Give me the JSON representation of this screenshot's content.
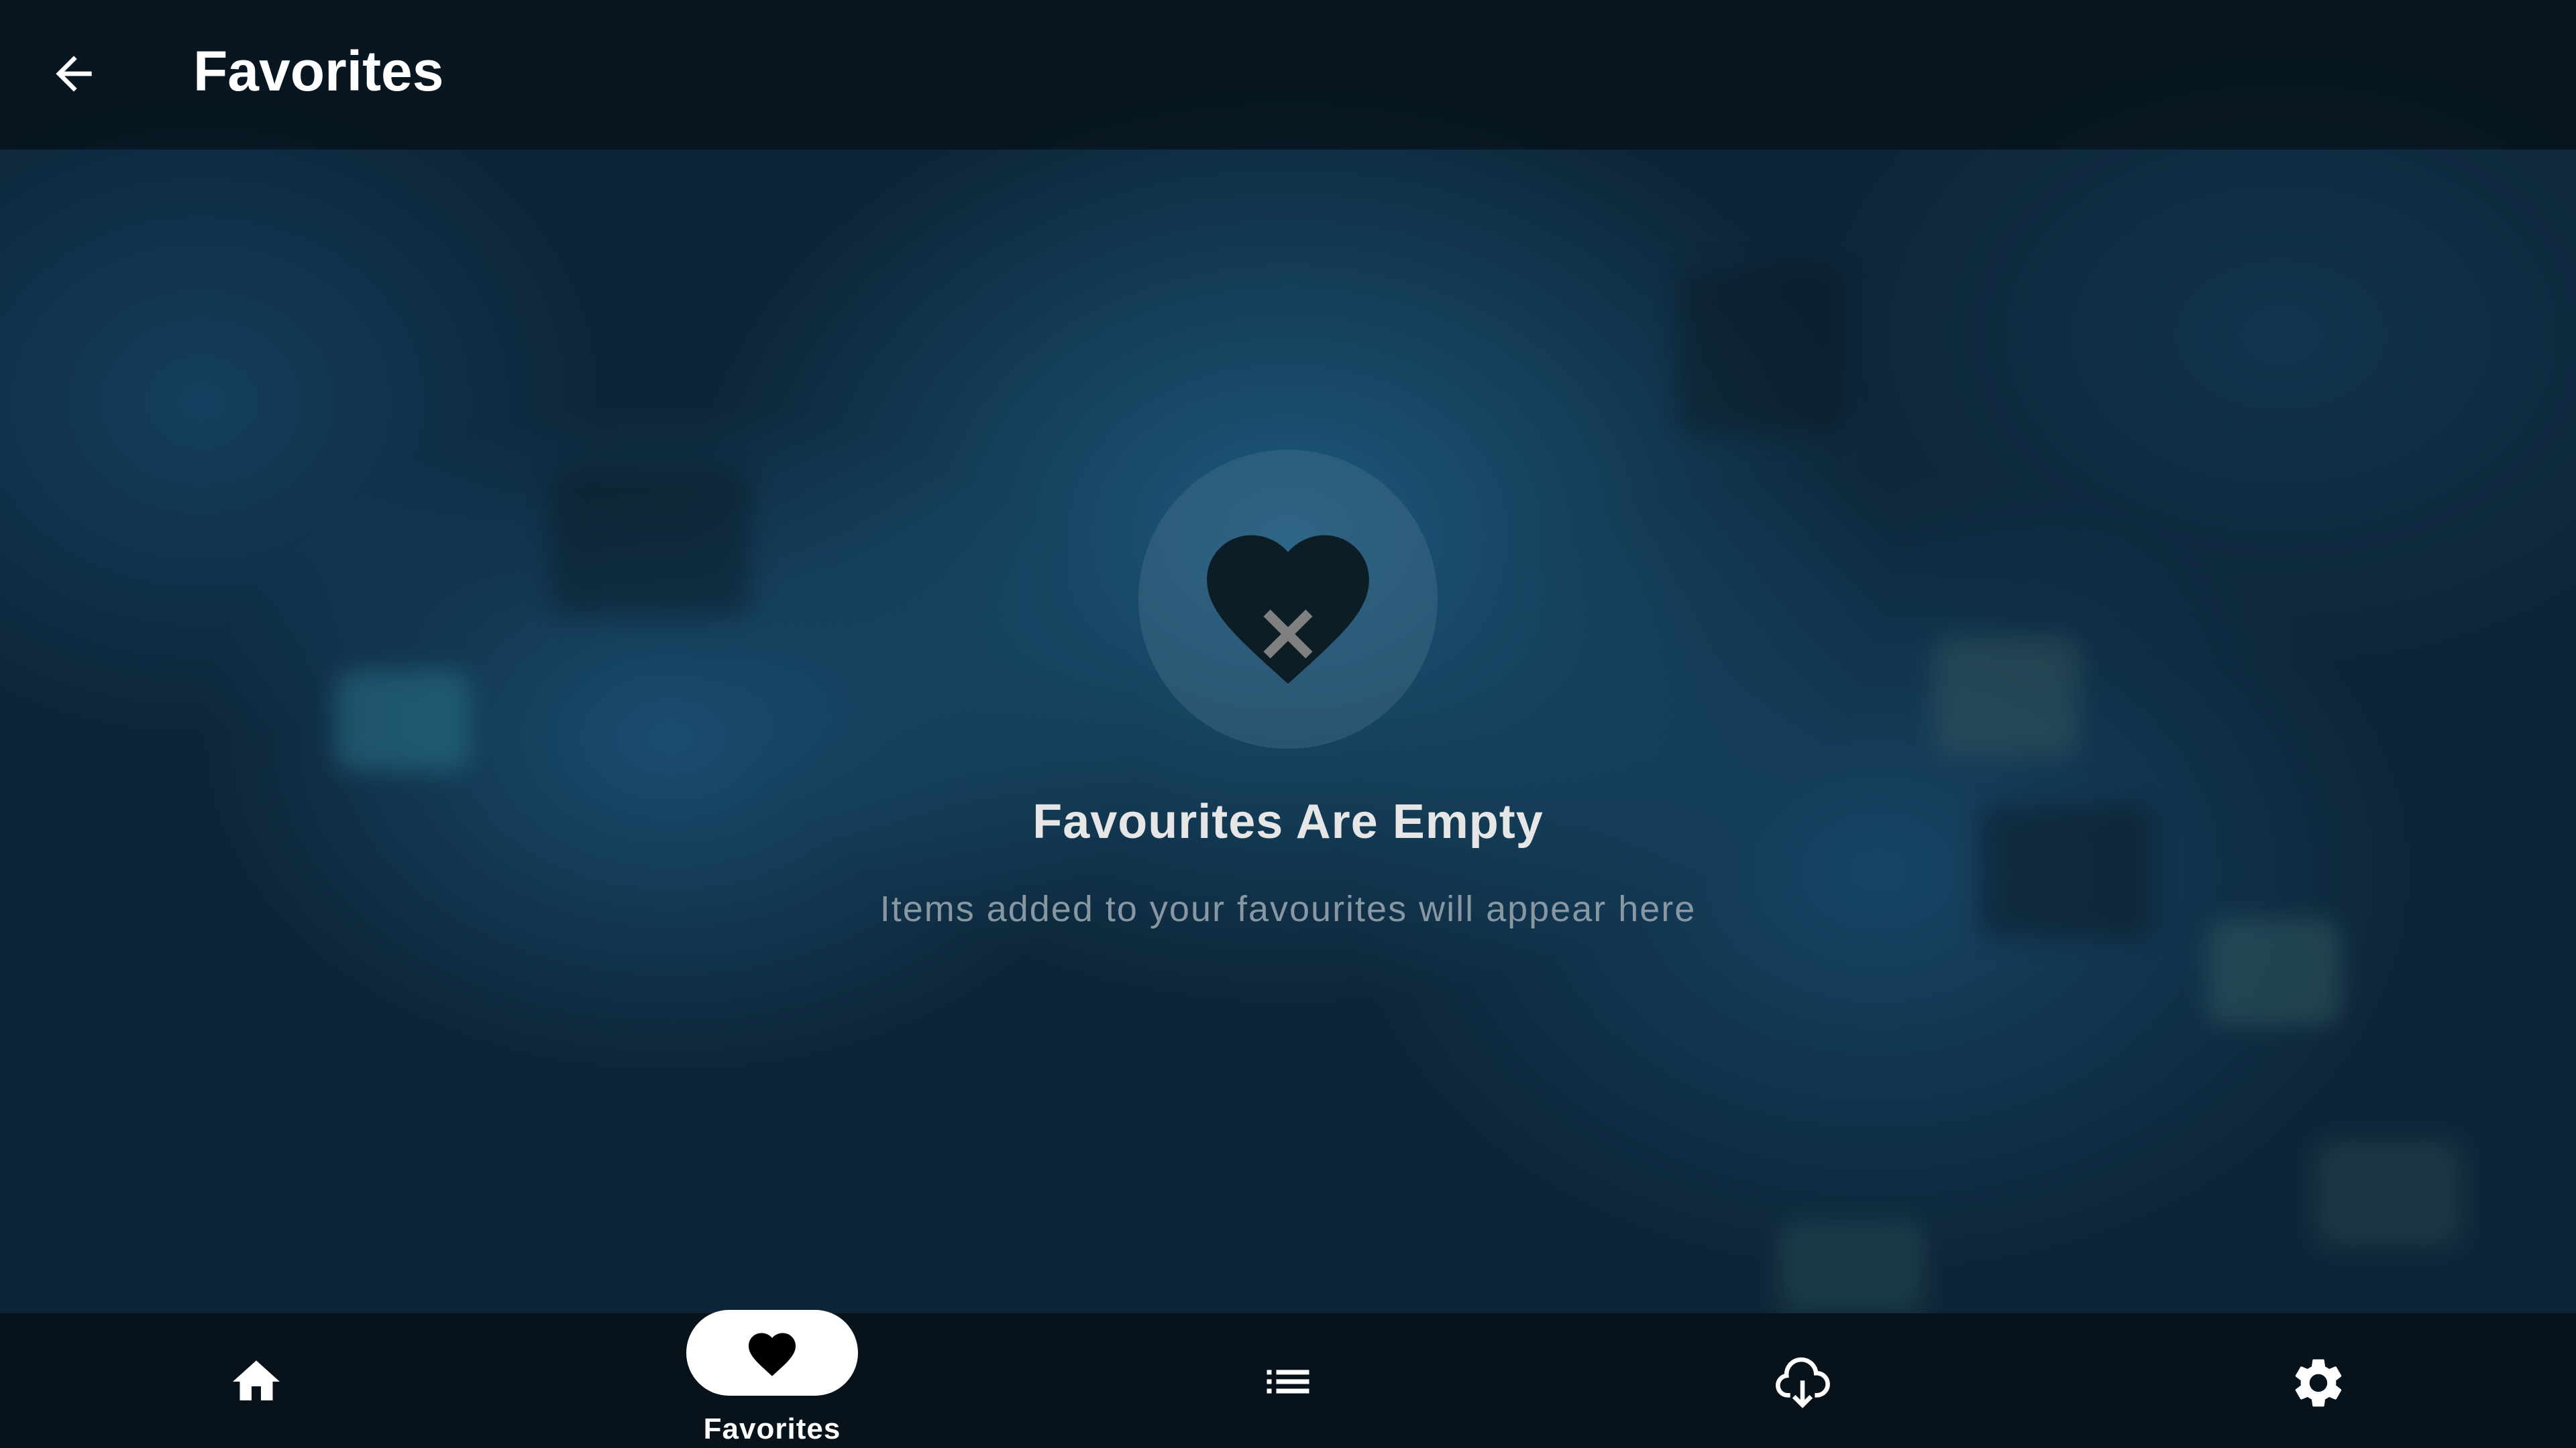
{
  "header": {
    "title": "Favorites",
    "back_icon": "arrow-left-icon"
  },
  "empty_state": {
    "icon": "heart-x-icon",
    "title": "Favourites Are Empty",
    "subtitle": "Items added to your favourites will appear here"
  },
  "bottom_nav": {
    "items": [
      {
        "icon": "home-icon",
        "label": "Home",
        "selected": false
      },
      {
        "icon": "heart-icon",
        "label": "Favorites",
        "selected": true
      },
      {
        "icon": "list-icon",
        "label": "List",
        "selected": false
      },
      {
        "icon": "cloud-download-icon",
        "label": "Downloads",
        "selected": false
      },
      {
        "icon": "gear-icon",
        "label": "Settings",
        "selected": false
      }
    ],
    "selected_label": "Favorites"
  },
  "colors": {
    "accent": "#ffffff",
    "nav_bg": "#07121a",
    "background": "#0d2538"
  }
}
